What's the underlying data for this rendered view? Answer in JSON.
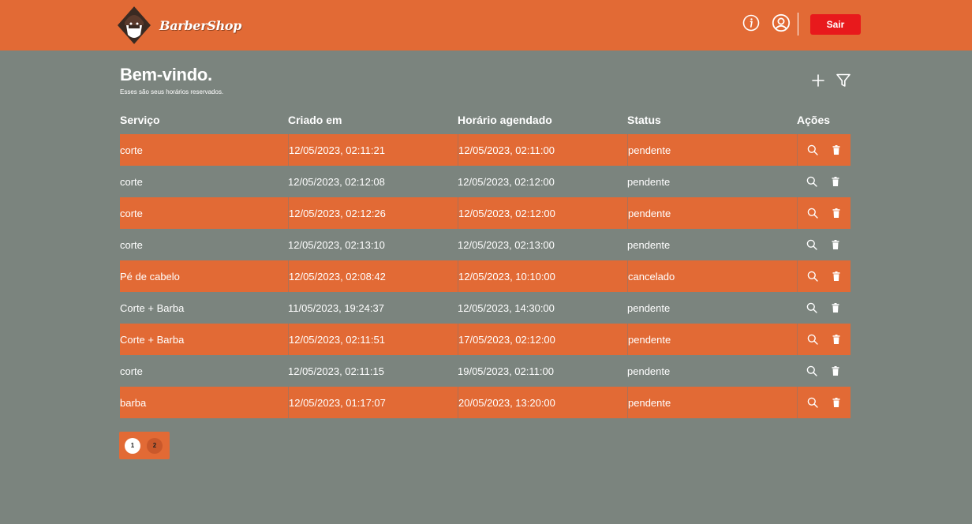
{
  "header": {
    "brand": "BarberShop",
    "logout_label": "Sair",
    "icons": [
      "info-icon",
      "user-icon"
    ]
  },
  "welcome": {
    "title": "Bem-vindo.",
    "subtitle": "Esses são seus horários reservados."
  },
  "toolbar": {
    "icons": [
      "plus-icon",
      "filter-icon"
    ]
  },
  "table": {
    "columns": [
      "Serviço",
      "Criado em",
      "Horário agendado",
      "Status",
      "Ações"
    ],
    "rows": [
      {
        "servico": "corte",
        "criado": "12/05/2023, 02:11:21",
        "agendado": "12/05/2023, 02:11:00",
        "status": "pendente"
      },
      {
        "servico": "corte",
        "criado": "12/05/2023, 02:12:08",
        "agendado": "12/05/2023, 02:12:00",
        "status": "pendente"
      },
      {
        "servico": "corte",
        "criado": "12/05/2023, 02:12:26",
        "agendado": "12/05/2023, 02:12:00",
        "status": "pendente"
      },
      {
        "servico": "corte",
        "criado": "12/05/2023, 02:13:10",
        "agendado": "12/05/2023, 02:13:00",
        "status": "pendente"
      },
      {
        "servico": "Pé de cabelo",
        "criado": "12/05/2023, 02:08:42",
        "agendado": "12/05/2023, 10:10:00",
        "status": "cancelado"
      },
      {
        "servico": "Corte + Barba",
        "criado": "11/05/2023, 19:24:37",
        "agendado": "12/05/2023, 14:30:00",
        "status": "pendente"
      },
      {
        "servico": "Corte + Barba",
        "criado": "12/05/2023, 02:11:51",
        "agendado": "17/05/2023, 02:12:00",
        "status": "pendente"
      },
      {
        "servico": "corte",
        "criado": "12/05/2023, 02:11:15",
        "agendado": "19/05/2023, 02:11:00",
        "status": "pendente"
      },
      {
        "servico": "barba",
        "criado": "12/05/2023, 01:17:07",
        "agendado": "20/05/2023, 13:20:00",
        "status": "pendente"
      }
    ],
    "row_action_icons": [
      "search-icon",
      "trash-icon"
    ]
  },
  "pagination": {
    "pages": [
      "1",
      "2"
    ],
    "current": "1"
  },
  "colors": {
    "accent": "#e26a35",
    "background": "#7b847e",
    "danger": "#e8191c",
    "text": "#ffffff"
  }
}
